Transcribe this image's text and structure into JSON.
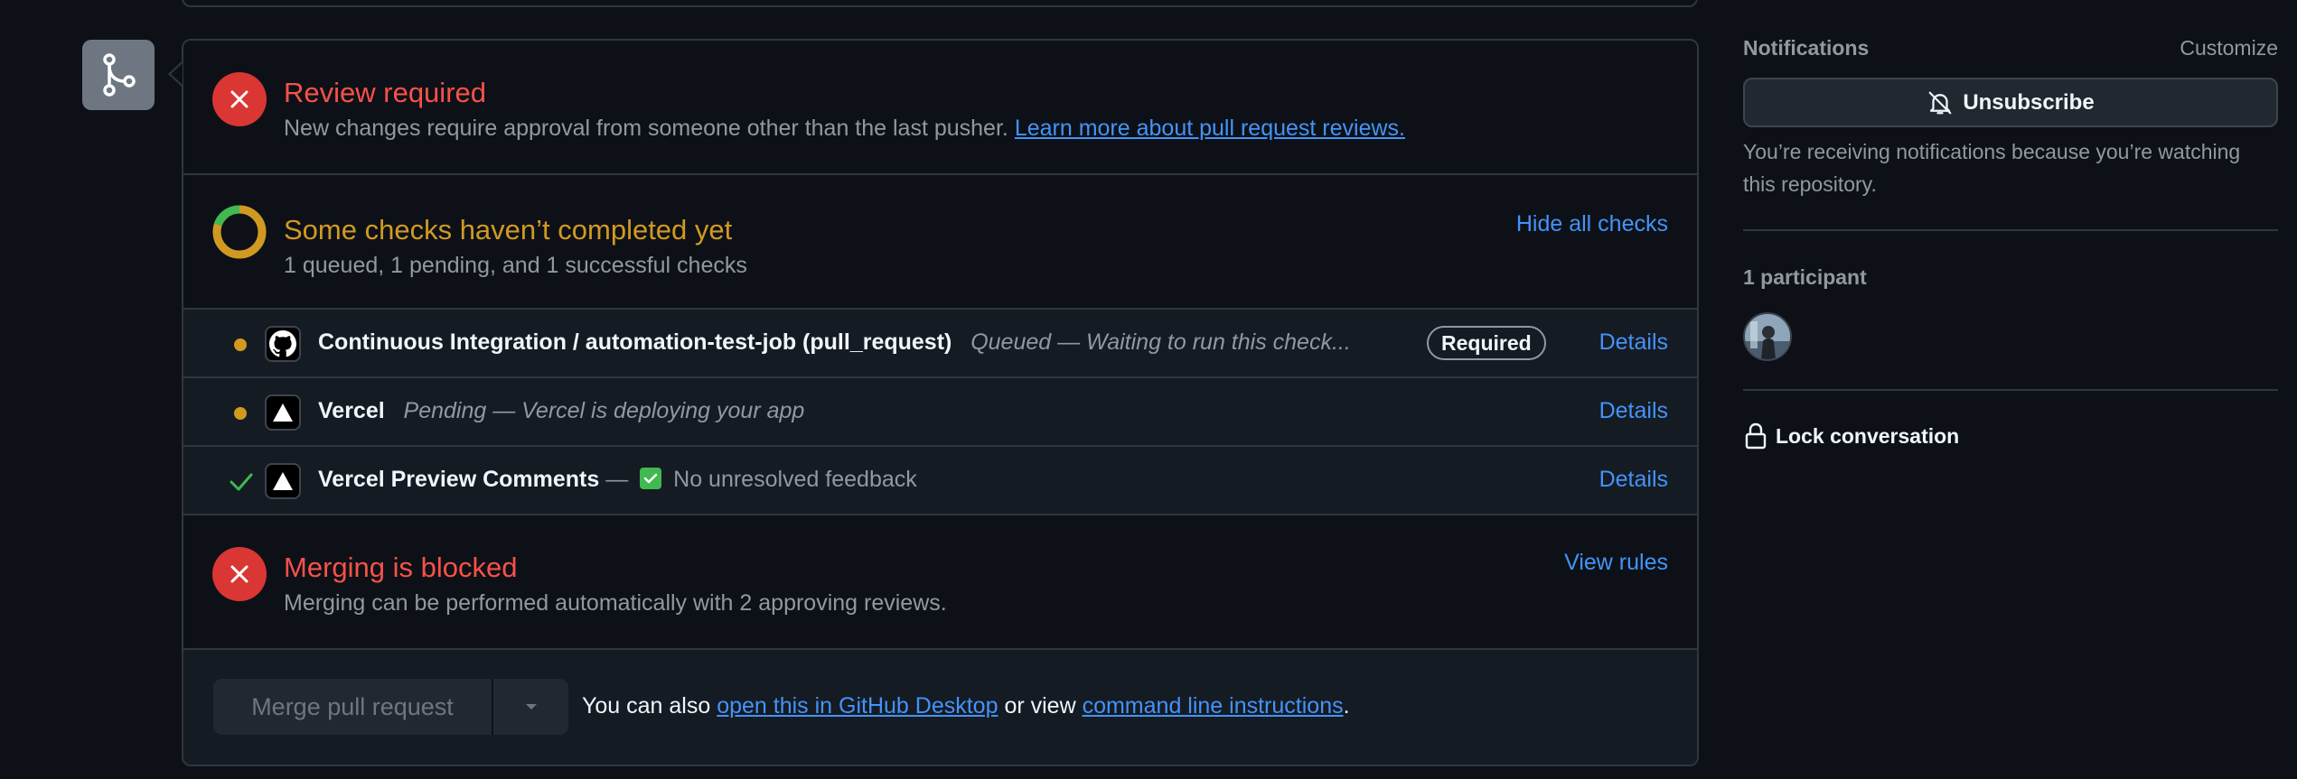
{
  "mergebox": {
    "review": {
      "title": "Review required",
      "text": "New changes require approval from someone other than the last pusher.",
      "link": "Learn more about pull request reviews."
    },
    "checks": {
      "title": "Some checks haven’t completed yet",
      "summary": "1 queued, 1 pending, and 1 successful checks",
      "toggle_link": "Hide all checks",
      "rows": [
        {
          "status": "queued",
          "name": "Continuous Integration / automation-test-job (pull_request)",
          "description": "Queued — Waiting to run this check...",
          "badge": "Required",
          "details": "Details"
        },
        {
          "status": "pending",
          "name": "Vercel",
          "description": "Pending — Vercel is deploying your app",
          "details": "Details"
        },
        {
          "status": "success",
          "name": "Vercel Preview Comments",
          "separator": "—",
          "description": "No unresolved feedback",
          "details": "Details"
        }
      ]
    },
    "blocked": {
      "title": "Merging is blocked",
      "text": "Merging can be performed automatically with 2 approving reviews.",
      "link": "View rules"
    },
    "actions": {
      "merge_button": "Merge pull request",
      "help_prefix": "You can also",
      "desktop_link": "open this in GitHub Desktop",
      "help_middle": "or view",
      "cli_link": "command line instructions",
      "help_suffix": "."
    }
  },
  "sidebar": {
    "notifications_heading": "Notifications",
    "customize": "Customize",
    "unsubscribe": "Unsubscribe",
    "notification_note": "You’re receiving notifications because you’re watching this repository.",
    "participants_heading": "1 participant",
    "lock": "Lock conversation"
  },
  "colors": {
    "danger": "#da3633",
    "attention": "#d29922",
    "success": "#3fb950",
    "link": "#4493f8",
    "background": "#0d1117"
  }
}
